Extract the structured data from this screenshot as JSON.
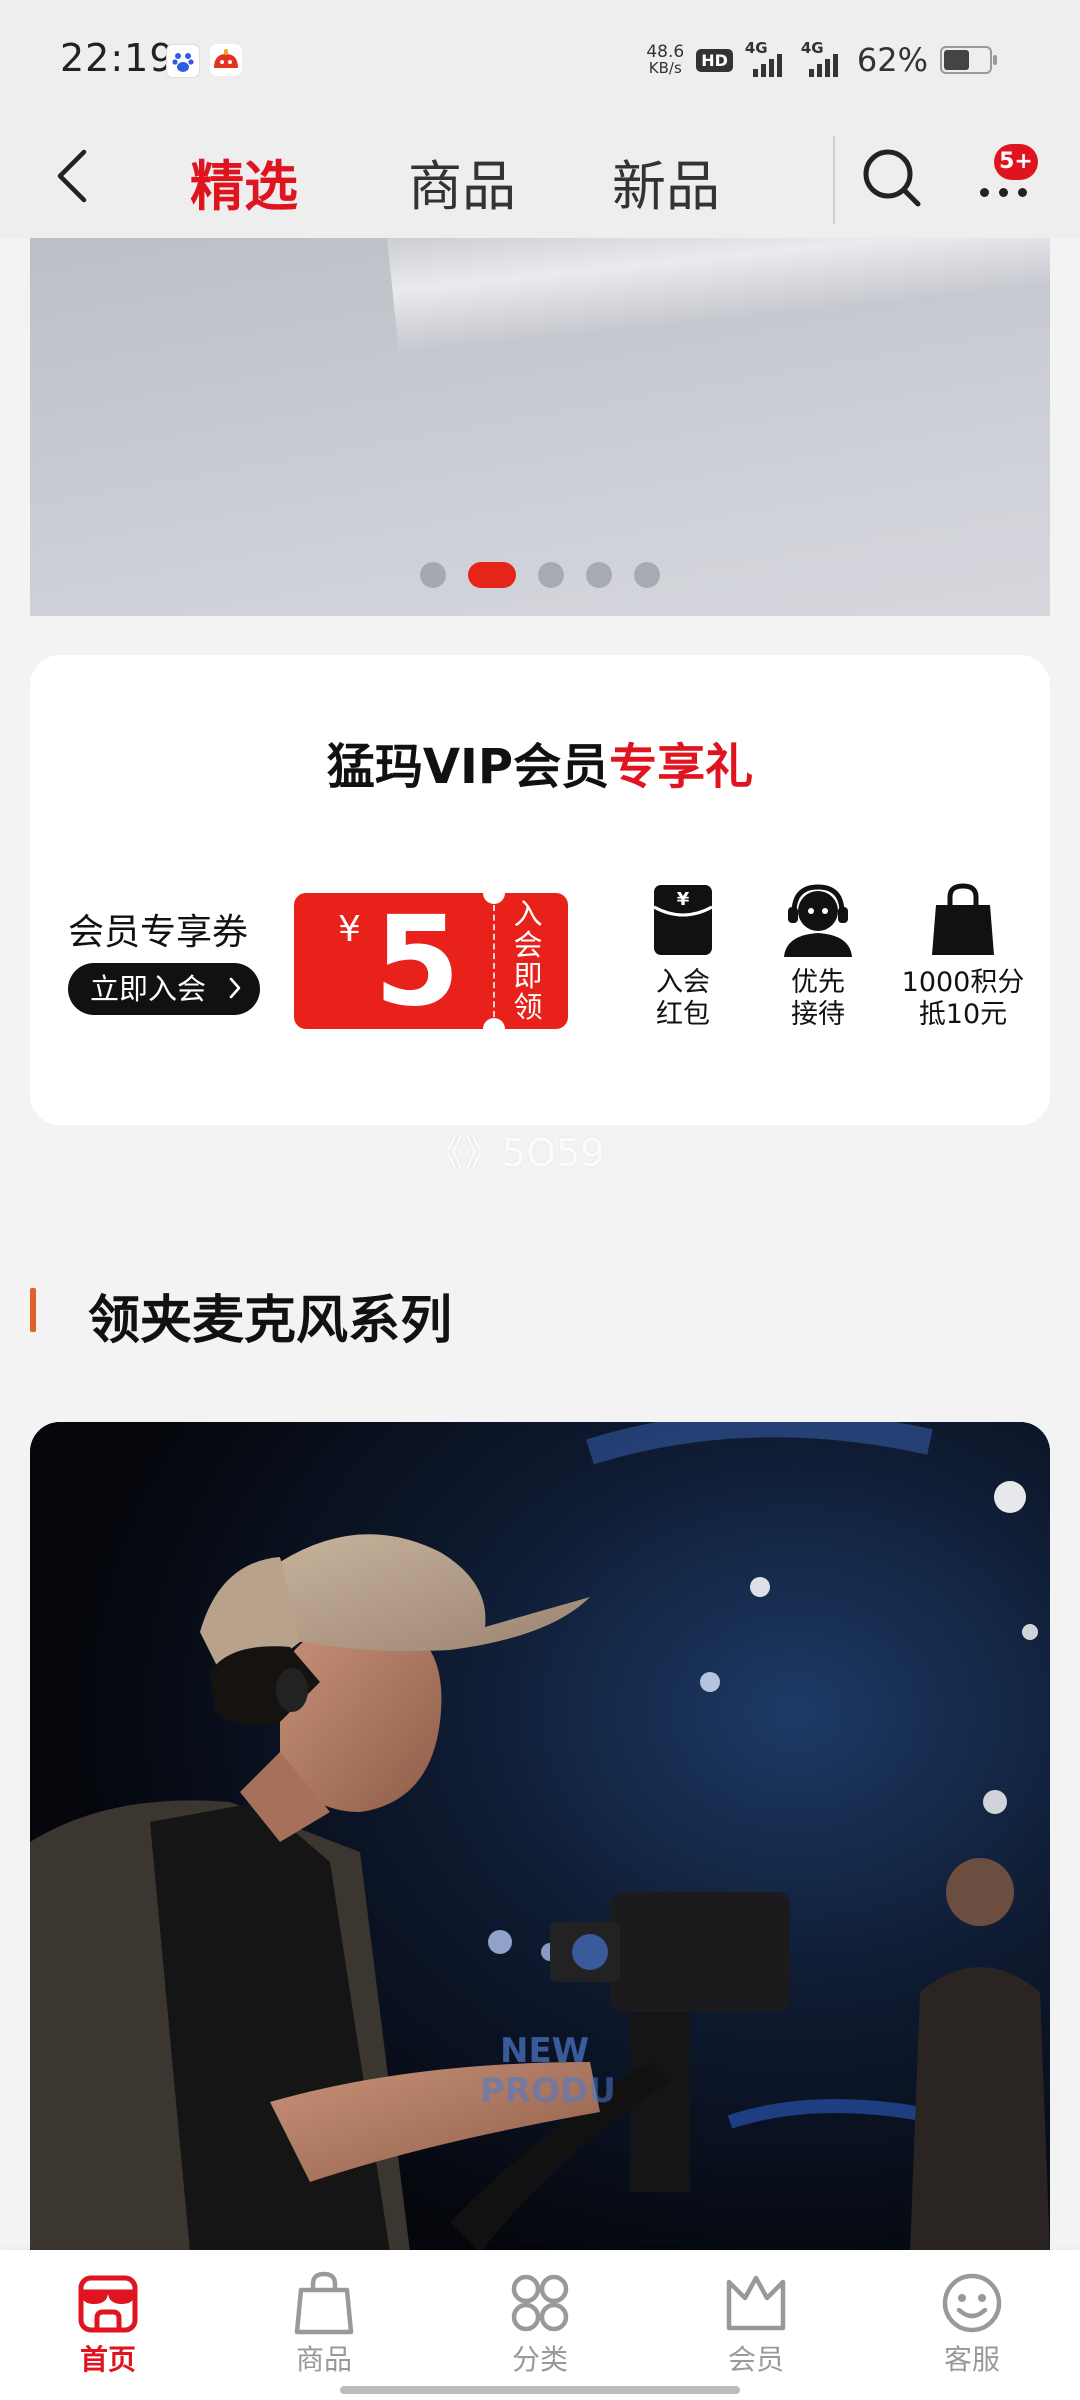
{
  "status_bar": {
    "time": "22:19",
    "net_speed_value": "48.6",
    "net_speed_unit": "KB/s",
    "hd_label": "HD",
    "signal_1_label": "4G",
    "signal_2_label": "4G",
    "battery_percent": "62%",
    "battery_level": 0.62
  },
  "header": {
    "tabs": [
      {
        "label": "精选",
        "active": true
      },
      {
        "label": "商品",
        "active": false
      },
      {
        "label": "新品",
        "active": false
      }
    ],
    "message_badge": "5+"
  },
  "banner": {
    "slide_count": 5,
    "active_slide": 2
  },
  "vip": {
    "title_prefix": "猛玛VIP会员",
    "title_highlight": "专享礼",
    "coupon_label": "会员专享券",
    "join_button": "立即入会",
    "coupon_currency": "¥",
    "coupon_amount": "5",
    "coupon_side_text": "入会即领",
    "perks": [
      {
        "label": "入会\n红包",
        "icon": "red-envelope-icon"
      },
      {
        "label": "优先\n接待",
        "icon": "headset-agent-icon"
      },
      {
        "label": "1000积分\n抵10元",
        "icon": "shopping-bag-icon"
      }
    ]
  },
  "watermark": "《》5O59",
  "section": {
    "title": "领夹麦克风系列"
  },
  "promo_image": {
    "description_icon": "photo"
  },
  "bottom_nav": {
    "items": [
      {
        "label": "首页",
        "icon": "store-icon",
        "active": true
      },
      {
        "label": "商品",
        "icon": "bag-icon",
        "active": false
      },
      {
        "label": "分类",
        "icon": "category-icon",
        "active": false
      },
      {
        "label": "会员",
        "icon": "crown-icon",
        "active": false
      },
      {
        "label": "客服",
        "icon": "smile-service-icon",
        "active": false
      }
    ]
  },
  "colors": {
    "accent_red": "#e0141e",
    "coupon_red": "#e8221a",
    "section_bar": "#e0602a"
  }
}
